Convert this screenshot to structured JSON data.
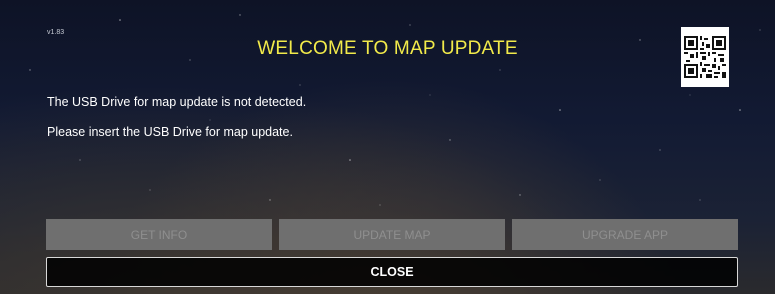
{
  "header": {
    "version": "v1.83",
    "title": "WELCOME TO MAP UPDATE",
    "qr_icon": "qr-code-icon"
  },
  "messages": {
    "line1": "The USB Drive for map update is not detected.",
    "line2": "Please insert the USB Drive for map update."
  },
  "actions": {
    "get_info": "GET INFO",
    "update_map": "UPDATE MAP",
    "upgrade_app": "UPGRADE APP",
    "close": "CLOSE"
  },
  "colors": {
    "title": "#f2ea4a",
    "disabled_button": "#6f6f6f",
    "disabled_text": "#8f8f8f"
  }
}
